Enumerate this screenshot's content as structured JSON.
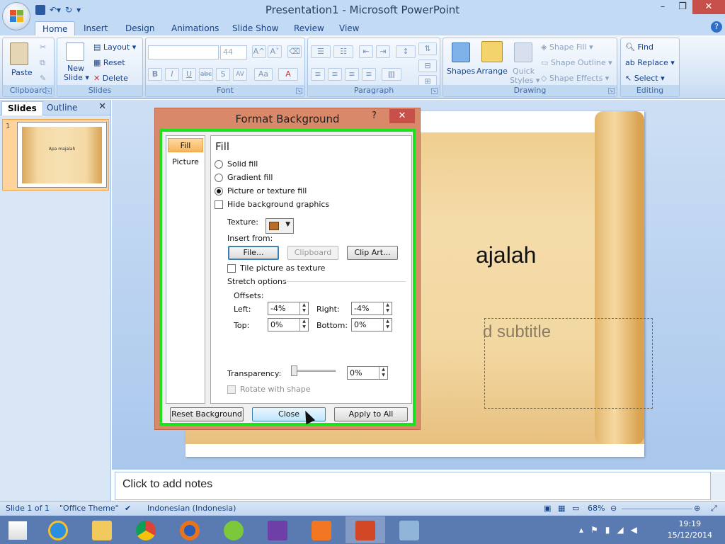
{
  "app": {
    "title": "Presentation1 - Microsoft PowerPoint",
    "colors": {
      "accent": "#1e395b",
      "close": "#c7504a",
      "dialog_frame": "#d9896a",
      "highlight": "#1fe21f"
    }
  },
  "window_controls": {
    "minimize": "–",
    "restore": "❐",
    "close": "✕"
  },
  "quick_access": {
    "save_icon": "save-icon",
    "undo_icon": "undo-icon",
    "redo_icon": "redo-icon",
    "customize_icon": "▾"
  },
  "ribbon": {
    "tabs": [
      "Home",
      "Insert",
      "Design",
      "Animations",
      "Slide Show",
      "Review",
      "View"
    ],
    "active_tab": "Home",
    "help": "?",
    "groups": {
      "clipboard": {
        "label": "Clipboard",
        "paste": "Paste"
      },
      "slides": {
        "label": "Slides",
        "new_slide_line1": "New",
        "new_slide_line2": "Slide ▾",
        "layout": "Layout ▾",
        "reset": "Reset",
        "delete": "Delete"
      },
      "font": {
        "label": "Font",
        "font_name": "",
        "font_size": "44",
        "bold": "B",
        "italic": "I",
        "underline": "U",
        "strike": "abc",
        "shadow": "S",
        "spacing": "AV",
        "case": "Aa",
        "color": "A",
        "grow": "A^",
        "shrink": "A˅"
      },
      "paragraph": {
        "label": "Paragraph"
      },
      "drawing": {
        "label": "Drawing",
        "shapes": "Shapes",
        "arrange": "Arrange",
        "quick_styles_line1": "Quick",
        "quick_styles_line2": "Styles ▾",
        "shape_fill": "Shape Fill ▾",
        "shape_outline": "Shape Outline ▾",
        "shape_effects": "Shape Effects ▾"
      },
      "editing": {
        "label": "Editing",
        "find": "Find",
        "replace": "Replace ▾",
        "select": "Select ▾"
      }
    }
  },
  "left_pane": {
    "tabs": [
      "Slides",
      "Outline"
    ],
    "close": "✕",
    "thumbnails": [
      {
        "number": "1",
        "text": "Apa majalah"
      }
    ]
  },
  "slide": {
    "title": "ajalah",
    "subtitle": "d subtitle"
  },
  "notes": {
    "placeholder": "Click to add notes"
  },
  "status_bar": {
    "slide_info": "Slide 1 of 1",
    "theme": "\"Office Theme\"",
    "language": "Indonesian (Indonesia)",
    "zoom": "68%"
  },
  "dialog": {
    "title": "Format Background",
    "help": "?",
    "close": "✕",
    "nav": [
      {
        "label": "Fill",
        "selected": true
      },
      {
        "label": "Picture",
        "selected": false
      }
    ],
    "section_title": "Fill",
    "fill_options": [
      {
        "label": "Solid fill",
        "selected": false
      },
      {
        "label": "Gradient fill",
        "selected": false
      },
      {
        "label": "Picture or texture fill",
        "selected": true
      }
    ],
    "hide_background": {
      "label": "Hide background graphics",
      "checked": false
    },
    "texture_label": "Texture:",
    "insert_from_label": "Insert from:",
    "insert_buttons": {
      "file": "File...",
      "clipboard": "Clipboard",
      "clip_art": "Clip Art..."
    },
    "tile": {
      "label": "Tile picture as texture",
      "checked": false
    },
    "stretch_options": "Stretch options",
    "offsets_label": "Offsets:",
    "offsets": {
      "left": {
        "label": "Left:",
        "value": "-4%"
      },
      "right": {
        "label": "Right:",
        "value": "-4%"
      },
      "top": {
        "label": "Top:",
        "value": "0%"
      },
      "bottom": {
        "label": "Bottom:",
        "value": "0%"
      }
    },
    "transparency": {
      "label": "Transparency:",
      "value": "0%"
    },
    "rotate": {
      "label": "Rotate with shape",
      "checked": false,
      "disabled": true
    },
    "footer": {
      "reset": "Reset Background",
      "close": "Close",
      "apply_all": "Apply to All"
    }
  },
  "taskbar": {
    "apps": [
      "start-icon",
      "ie-icon",
      "explorer-icon",
      "chrome-icon",
      "firefox-icon",
      "dreamweaver-icon",
      "visual-studio-icon",
      "xampp-icon",
      "powerpoint-icon",
      "app-icon"
    ],
    "clock_time": "19:19",
    "clock_date": "15/12/2014"
  }
}
